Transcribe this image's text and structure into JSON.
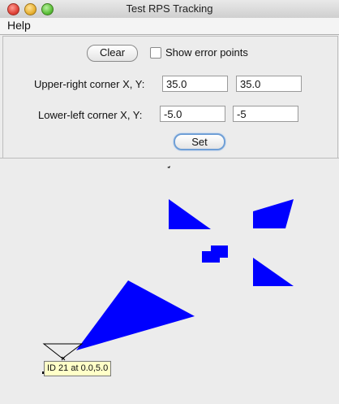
{
  "window": {
    "title": "Test RPS Tracking"
  },
  "menubar": {
    "items": [
      {
        "label": "Help"
      }
    ]
  },
  "controls": {
    "clear_label": "Clear",
    "show_error_points_label": "Show error points",
    "show_error_points_checked": false,
    "upper_right_label": "Upper-right corner X, Y:",
    "upper_right_x": "35.0",
    "upper_right_y": "35.0",
    "lower_left_label": "Lower-left corner X, Y:",
    "lower_left_x": "-5.0",
    "lower_left_y": "-5",
    "set_label": "Set"
  },
  "canvas": {
    "shape_color": "#0000ff",
    "tooltip": "ID 21 at 0.0,5.0"
  }
}
